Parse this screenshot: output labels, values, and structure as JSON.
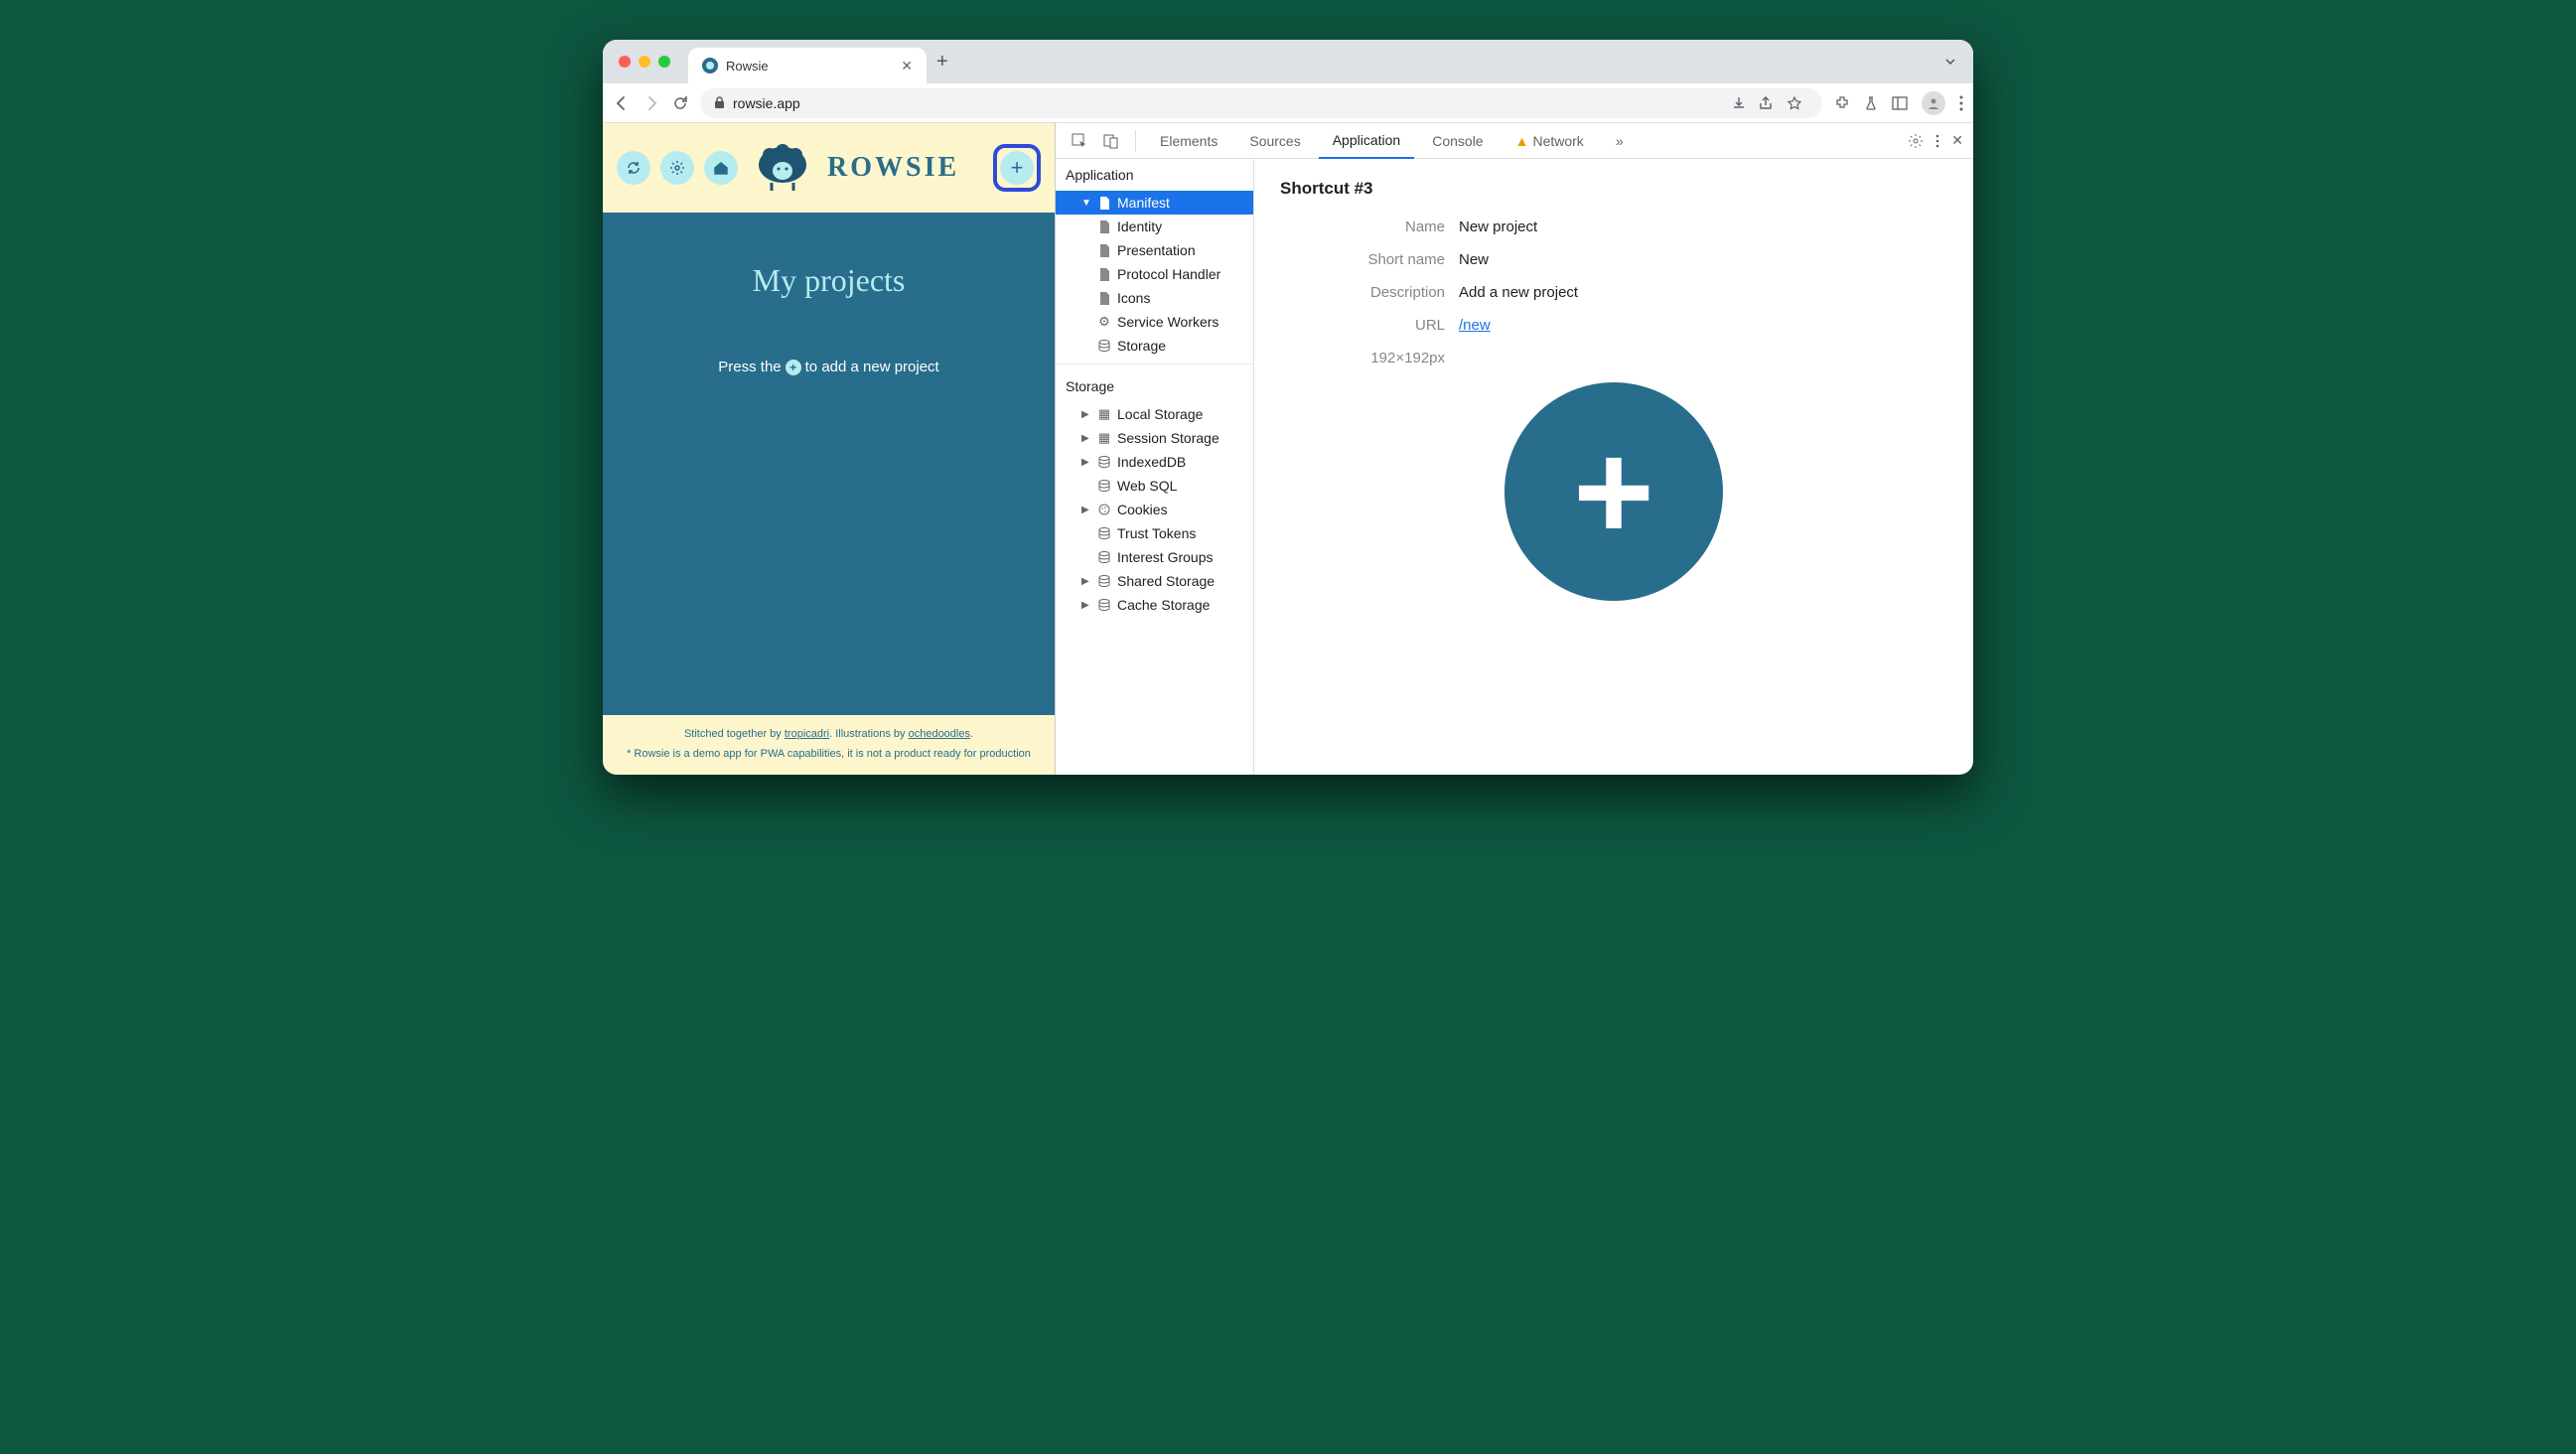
{
  "browser": {
    "tab_title": "Rowsie",
    "url": "rowsie.app"
  },
  "app": {
    "wordmark": "ROWSIE",
    "projects_title": "My projects",
    "hint_before": "Press the",
    "hint_after": "to add a new project",
    "footer_line1_a": "Stitched together by ",
    "footer_link1": "tropicadri",
    "footer_line1_b": ". Illustrations by ",
    "footer_link2": "ochedoodles",
    "footer_line1_c": ".",
    "footer_line2": "* Rowsie is a demo app for PWA capabilities, it is not a product ready for production"
  },
  "devtools": {
    "tabs": [
      "Elements",
      "Sources",
      "Application",
      "Console",
      "Network"
    ],
    "active_tab": "Application",
    "more": "»",
    "sidebar": {
      "section1": "Application",
      "manifest": "Manifest",
      "identity": "Identity",
      "presentation": "Presentation",
      "protocol": "Protocol Handler",
      "icons": "Icons",
      "sw": "Service Workers",
      "storage_item": "Storage",
      "section2": "Storage",
      "local": "Local Storage",
      "session": "Session Storage",
      "indexed": "IndexedDB",
      "websql": "Web SQL",
      "cookies": "Cookies",
      "trust": "Trust Tokens",
      "interest": "Interest Groups",
      "shared": "Shared Storage",
      "cache": "Cache Storage"
    },
    "detail": {
      "title": "Shortcut #3",
      "name_k": "Name",
      "name_v": "New project",
      "short_k": "Short name",
      "short_v": "New",
      "desc_k": "Description",
      "desc_v": "Add a new project",
      "url_k": "URL",
      "url_v": "/new",
      "dim_k": "192×192px"
    }
  }
}
